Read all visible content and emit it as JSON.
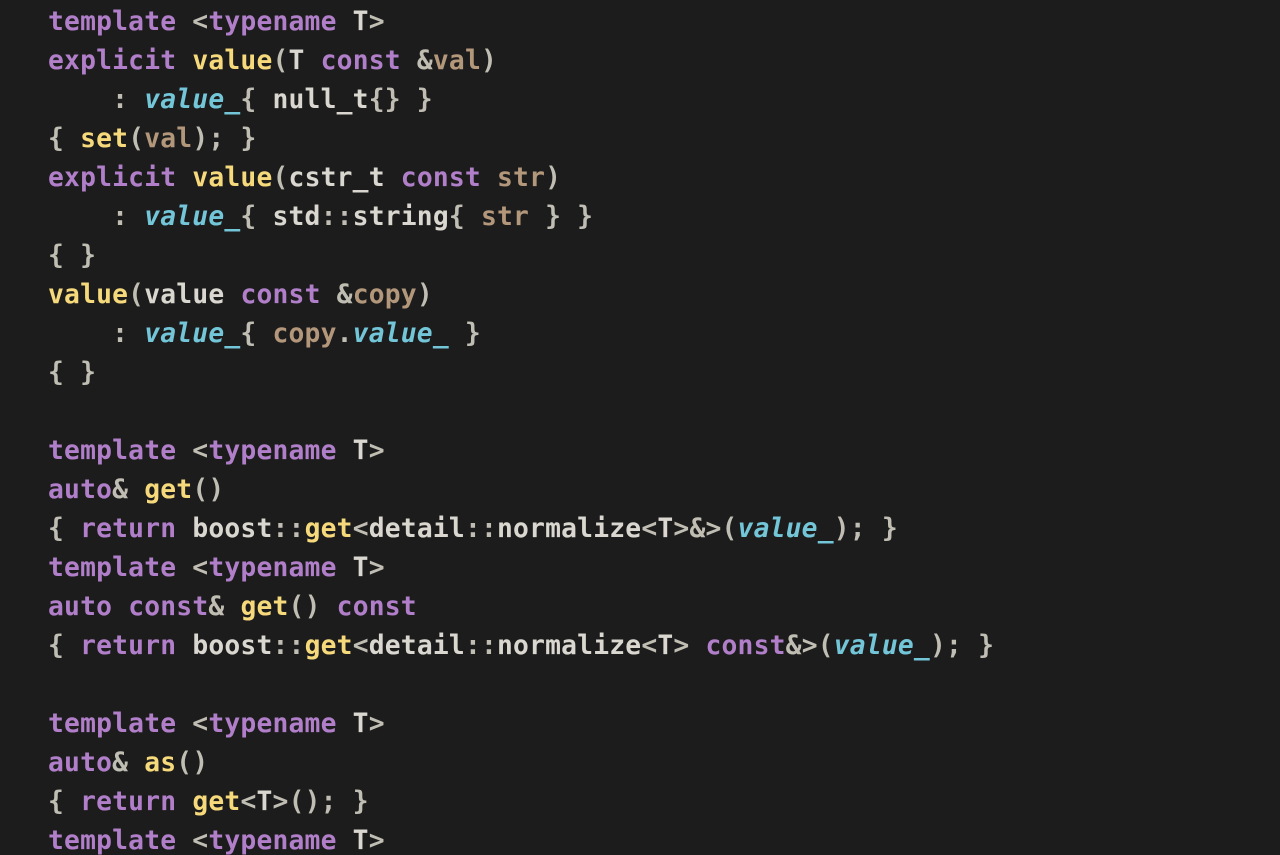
{
  "colors": {
    "background": "#1c1c1c",
    "text": "#d9d7cf",
    "keyword": "#b17fc9",
    "function": "#f5d97b",
    "member": "#73c5d8",
    "param": "#b3977b",
    "punct": "#c0bdb3"
  },
  "language": "C++",
  "code_tokens": [
    [
      [
        "kw",
        "template"
      ],
      [
        "pun",
        " <"
      ],
      [
        "kw",
        "typename"
      ],
      [
        "type",
        " T"
      ],
      [
        "pun",
        ">"
      ]
    ],
    [
      [
        "kw",
        "explicit"
      ],
      [
        "type",
        " "
      ],
      [
        "func",
        "value"
      ],
      [
        "pun",
        "("
      ],
      [
        "type",
        "T"
      ],
      [
        "type",
        " "
      ],
      [
        "kw",
        "const"
      ],
      [
        "type",
        " "
      ],
      [
        "pun",
        "&"
      ],
      [
        "prm",
        "val"
      ],
      [
        "pun",
        ")"
      ]
    ],
    [
      [
        "pun",
        "    : "
      ],
      [
        "mem",
        "value_"
      ],
      [
        "pun",
        "{ "
      ],
      [
        "type",
        "null_t"
      ],
      [
        "pun",
        "{} }"
      ]
    ],
    [
      [
        "pun",
        "{ "
      ],
      [
        "func",
        "set"
      ],
      [
        "pun",
        "("
      ],
      [
        "prm",
        "val"
      ],
      [
        "pun",
        "); }"
      ]
    ],
    [
      [
        "kw",
        "explicit"
      ],
      [
        "type",
        " "
      ],
      [
        "func",
        "value"
      ],
      [
        "pun",
        "("
      ],
      [
        "type",
        "cstr_t"
      ],
      [
        "type",
        " "
      ],
      [
        "kw",
        "const"
      ],
      [
        "type",
        " "
      ],
      [
        "prm",
        "str"
      ],
      [
        "pun",
        ")"
      ]
    ],
    [
      [
        "pun",
        "    : "
      ],
      [
        "mem",
        "value_"
      ],
      [
        "pun",
        "{ "
      ],
      [
        "scope",
        "std"
      ],
      [
        "pun",
        "::"
      ],
      [
        "type",
        "string"
      ],
      [
        "pun",
        "{ "
      ],
      [
        "prm",
        "str"
      ],
      [
        "pun",
        " } }"
      ]
    ],
    [
      [
        "pun",
        "{ }"
      ]
    ],
    [
      [
        "func",
        "value"
      ],
      [
        "pun",
        "("
      ],
      [
        "type",
        "value"
      ],
      [
        "type",
        " "
      ],
      [
        "kw",
        "const"
      ],
      [
        "type",
        " "
      ],
      [
        "pun",
        "&"
      ],
      [
        "prm",
        "copy"
      ],
      [
        "pun",
        ")"
      ]
    ],
    [
      [
        "pun",
        "    : "
      ],
      [
        "mem",
        "value_"
      ],
      [
        "pun",
        "{ "
      ],
      [
        "prm",
        "copy"
      ],
      [
        "pun",
        "."
      ],
      [
        "mem",
        "value_"
      ],
      [
        "pun",
        " }"
      ]
    ],
    [
      [
        "pun",
        "{ }"
      ]
    ],
    [],
    [
      [
        "kw",
        "template"
      ],
      [
        "pun",
        " <"
      ],
      [
        "kw",
        "typename"
      ],
      [
        "type",
        " T"
      ],
      [
        "pun",
        ">"
      ]
    ],
    [
      [
        "kw",
        "auto"
      ],
      [
        "pun",
        "& "
      ],
      [
        "func",
        "get"
      ],
      [
        "pun",
        "()"
      ]
    ],
    [
      [
        "pun",
        "{ "
      ],
      [
        "kw",
        "return"
      ],
      [
        "type",
        " "
      ],
      [
        "scope",
        "boost"
      ],
      [
        "pun",
        "::"
      ],
      [
        "func",
        "get"
      ],
      [
        "pun",
        "<"
      ],
      [
        "scope",
        "detail"
      ],
      [
        "pun",
        "::"
      ],
      [
        "norm",
        "normalize"
      ],
      [
        "pun",
        "<"
      ],
      [
        "type",
        "T"
      ],
      [
        "pun",
        ">&>("
      ],
      [
        "mem",
        "value_"
      ],
      [
        "pun",
        "); }"
      ]
    ],
    [
      [
        "kw",
        "template"
      ],
      [
        "pun",
        " <"
      ],
      [
        "kw",
        "typename"
      ],
      [
        "type",
        " T"
      ],
      [
        "pun",
        ">"
      ]
    ],
    [
      [
        "kw",
        "auto"
      ],
      [
        "type",
        " "
      ],
      [
        "kw",
        "const"
      ],
      [
        "pun",
        "& "
      ],
      [
        "func",
        "get"
      ],
      [
        "pun",
        "()"
      ],
      [
        "type",
        " "
      ],
      [
        "kw",
        "const"
      ]
    ],
    [
      [
        "pun",
        "{ "
      ],
      [
        "kw",
        "return"
      ],
      [
        "type",
        " "
      ],
      [
        "scope",
        "boost"
      ],
      [
        "pun",
        "::"
      ],
      [
        "func",
        "get"
      ],
      [
        "pun",
        "<"
      ],
      [
        "scope",
        "detail"
      ],
      [
        "pun",
        "::"
      ],
      [
        "norm",
        "normalize"
      ],
      [
        "pun",
        "<"
      ],
      [
        "type",
        "T"
      ],
      [
        "pun",
        "> "
      ],
      [
        "kw",
        "const"
      ],
      [
        "pun",
        "&>("
      ],
      [
        "mem",
        "value_"
      ],
      [
        "pun",
        "); }"
      ]
    ],
    [],
    [
      [
        "kw",
        "template"
      ],
      [
        "pun",
        " <"
      ],
      [
        "kw",
        "typename"
      ],
      [
        "type",
        " T"
      ],
      [
        "pun",
        ">"
      ]
    ],
    [
      [
        "kw",
        "auto"
      ],
      [
        "pun",
        "& "
      ],
      [
        "func",
        "as"
      ],
      [
        "pun",
        "()"
      ]
    ],
    [
      [
        "pun",
        "{ "
      ],
      [
        "kw",
        "return"
      ],
      [
        "type",
        " "
      ],
      [
        "func",
        "get"
      ],
      [
        "pun",
        "<"
      ],
      [
        "type",
        "T"
      ],
      [
        "pun",
        ">(); }"
      ]
    ],
    [
      [
        "kw",
        "template"
      ],
      [
        "pun",
        " <"
      ],
      [
        "kw",
        "typename"
      ],
      [
        "type",
        " T"
      ],
      [
        "pun",
        ">"
      ]
    ]
  ],
  "code_plain": "template <typename T>\nexplicit value(T const &val)\n    : value_{ null_t{} }\n{ set(val); }\nexplicit value(cstr_t const str)\n    : value_{ std::string{ str } }\n{ }\nvalue(value const &copy)\n    : value_{ copy.value_ }\n{ }\n\ntemplate <typename T>\nauto& get()\n{ return boost::get<detail::normalize<T>&>(value_); }\ntemplate <typename T>\nauto const& get() const\n{ return boost::get<detail::normalize<T> const&>(value_); }\n\ntemplate <typename T>\nauto& as()\n{ return get<T>(); }\ntemplate <typename T>"
}
